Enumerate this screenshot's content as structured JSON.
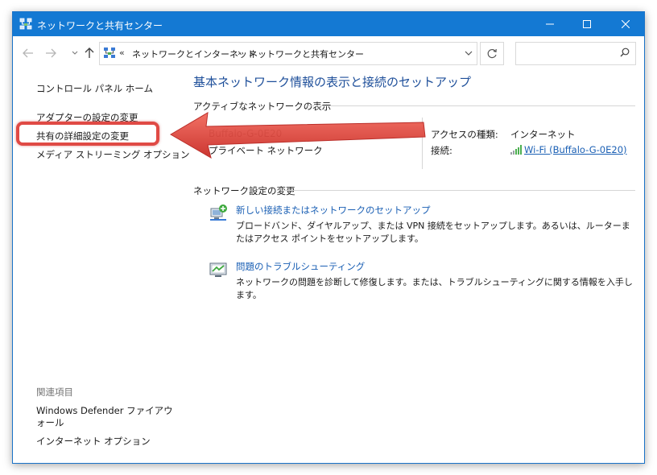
{
  "window": {
    "title": "ネットワークと共有センター",
    "controls": {
      "minimize": "minimize",
      "maximize": "maximize",
      "close": "close"
    }
  },
  "address": {
    "overflow": "«",
    "crumbs": [
      "ネットワークとインターネット",
      "ネットワークと共有センター"
    ],
    "separator": "›"
  },
  "search": {
    "placeholder": "",
    "value": ""
  },
  "sidebar": {
    "items": [
      {
        "label": "コントロール パネル ホーム"
      },
      {
        "label": "アダプターの設定の変更"
      },
      {
        "label": "共有の詳細設定の変更"
      },
      {
        "label": "メディア ストリーミング オプション"
      }
    ],
    "related_title": "関連項目",
    "related": [
      {
        "label": "Windows Defender ファイアウォール"
      },
      {
        "label": "インターネット オプション"
      }
    ]
  },
  "main": {
    "title": "基本ネットワーク情報の表示と接続のセットアップ",
    "active_section": "アクティブなネットワークの表示",
    "network": {
      "name": "Buffalo-G-0E20",
      "type": "プライベート ネットワーク",
      "access_label": "アクセスの種類:",
      "access_value": "インターネット",
      "connection_label": "接続:",
      "connection_value": "Wi-Fi (Buffalo-G-0E20)"
    },
    "change_section": "ネットワーク設定の変更",
    "tasks": [
      {
        "title": "新しい接続またはネットワークのセットアップ",
        "desc": "ブロードバンド、ダイヤルアップ、または VPN 接続をセットアップします。あるいは、ルーターまたはアクセス ポイントをセットアップします。"
      },
      {
        "title": "問題のトラブルシューティング",
        "desc": "ネットワークの問題を診断して修復します。または、トラブルシューティングに関する情報を入手します。"
      }
    ]
  },
  "colors": {
    "titlebar": "#1479d3",
    "link": "#1a5fb4",
    "heading": "#1e4f9a",
    "annotation": "#e04a45"
  }
}
